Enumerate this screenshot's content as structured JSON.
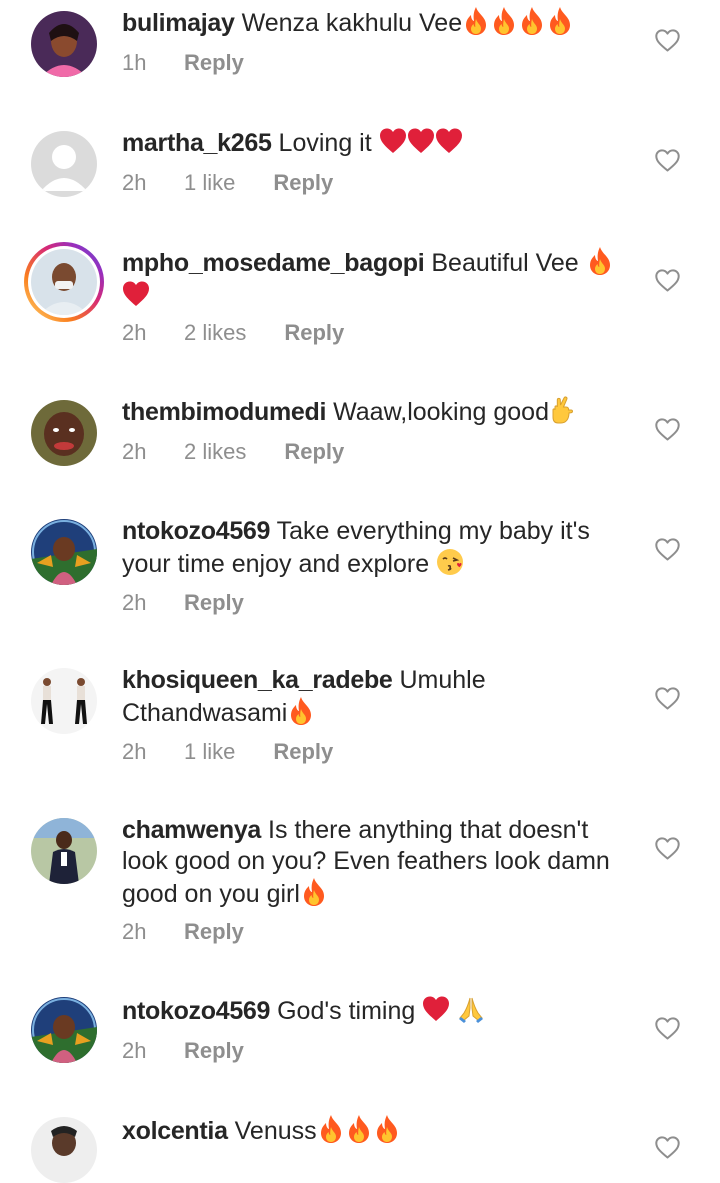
{
  "comments": [
    {
      "username": "bulimajay",
      "text": "Wenza kakhulu Vee",
      "emoji_tail": [
        "fire",
        "fire",
        "fire",
        "fire"
      ],
      "time": "1h",
      "likes": "",
      "reply": "Reply",
      "avatar": "avatar-bulimajay"
    },
    {
      "username": "martha_k265",
      "text": "Loving it",
      "emoji_tail": [
        "heart",
        "heart",
        "heart"
      ],
      "time": "2h",
      "likes": "1 like",
      "reply": "Reply",
      "avatar": "avatar-placeholder"
    },
    {
      "username": "mpho_mosedame_bagopi",
      "text": "Beautiful Vee",
      "emoji_tail": [
        "fire",
        "heart"
      ],
      "time": "2h",
      "likes": "2 likes",
      "reply": "Reply",
      "avatar": "avatar-mpho"
    },
    {
      "username": "thembimodumedi",
      "text": "Waaw,looking good",
      "emoji_tail": [
        "crossed-fingers"
      ],
      "time": "2h",
      "likes": "2 likes",
      "reply": "Reply",
      "avatar": "avatar-thembi"
    },
    {
      "username": "ntokozo4569",
      "text": "Take everything my baby it's your time enjoy and explore",
      "emoji_tail": [
        "kiss"
      ],
      "time": "2h",
      "likes": "",
      "reply": "Reply",
      "avatar": "avatar-ntokozo"
    },
    {
      "username": "khosiqueen_ka_radebe",
      "text": "Umuhle Cthandwasami",
      "emoji_tail": [
        "fire"
      ],
      "time": "2h",
      "likes": "1 like",
      "reply": "Reply",
      "avatar": "avatar-khosi"
    },
    {
      "username": "chamwenya",
      "text": "Is there anything that doesn't look good on you? Even feathers look damn good on you girl",
      "emoji_tail": [
        "fire"
      ],
      "time": "2h",
      "likes": "",
      "reply": "Reply",
      "avatar": "avatar-chamwenya"
    },
    {
      "username": "ntokozo4569",
      "text": "God's timing",
      "emoji_tail": [
        "heart",
        "pray"
      ],
      "time": "2h",
      "likes": "",
      "reply": "Reply",
      "avatar": "avatar-ntokozo"
    },
    {
      "username": "xolcentia",
      "text": "Venuss",
      "emoji_tail": [
        "fire",
        "fire",
        "fire"
      ],
      "time": "",
      "likes": "",
      "reply": "",
      "avatar": "avatar-xolcentia"
    }
  ],
  "colors": {
    "text": "#262626",
    "secondary": "#8e8e8e",
    "fire": "#ff5a1f",
    "heart": "#e0203a"
  }
}
